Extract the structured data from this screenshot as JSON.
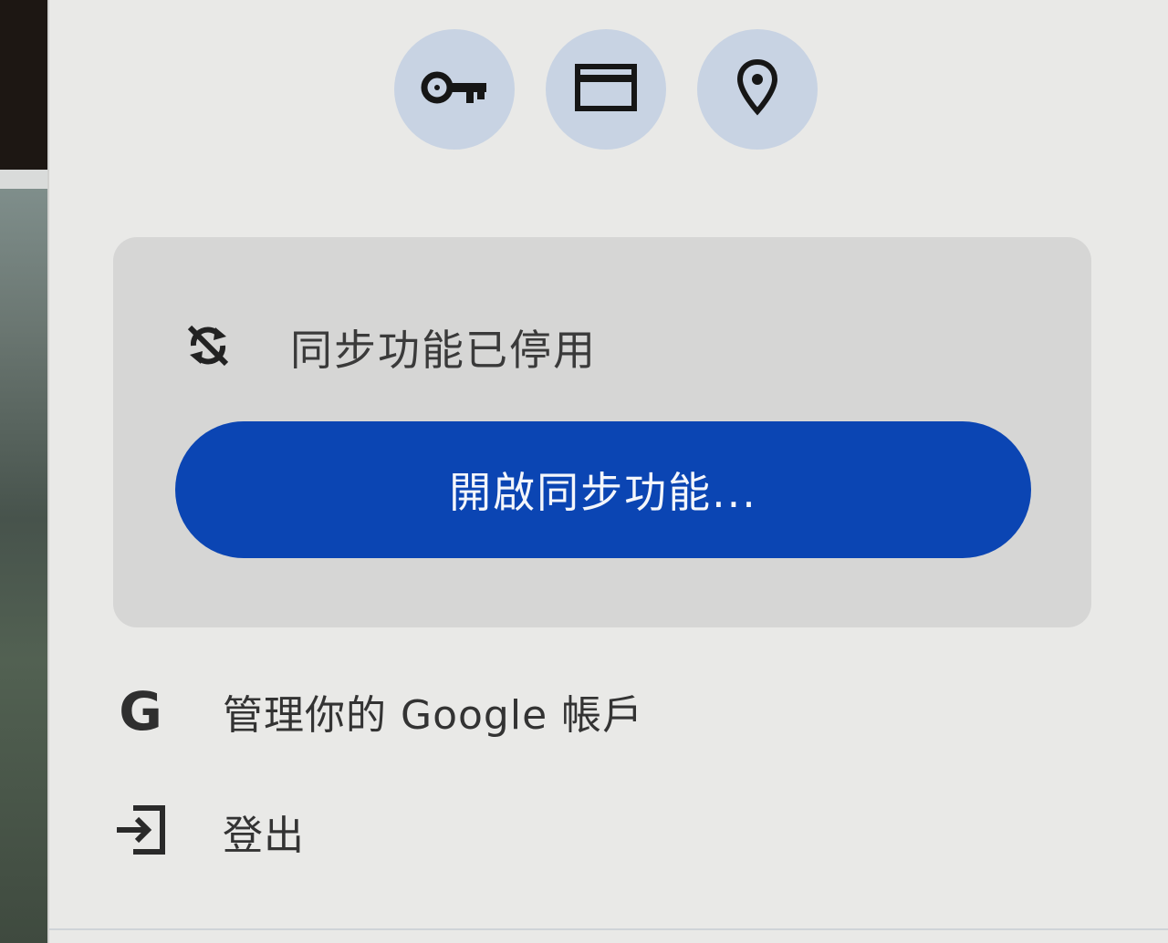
{
  "quick_actions": [
    {
      "icon": "key-icon",
      "name": "passwords"
    },
    {
      "icon": "credit-card-icon",
      "name": "payment-methods"
    },
    {
      "icon": "location-pin-icon",
      "name": "addresses"
    }
  ],
  "sync": {
    "status_text": "同步功能已停用",
    "status_icon": "sync-disabled-icon",
    "button_label": "開啟同步功能..."
  },
  "menu": {
    "manage_account": {
      "icon": "google-g-icon",
      "icon_glyph": "G",
      "label": "管理你的 Google 帳戶"
    },
    "sign_out": {
      "icon": "sign-out-icon",
      "label": "登出"
    }
  },
  "colors": {
    "panel_bg": "#e9e9e7",
    "quick_btn_bg": "#c8d3e3",
    "sync_card_bg": "#d6d6d5",
    "primary_button": "#0b45b3",
    "primary_button_text": "#f4f6fb"
  }
}
